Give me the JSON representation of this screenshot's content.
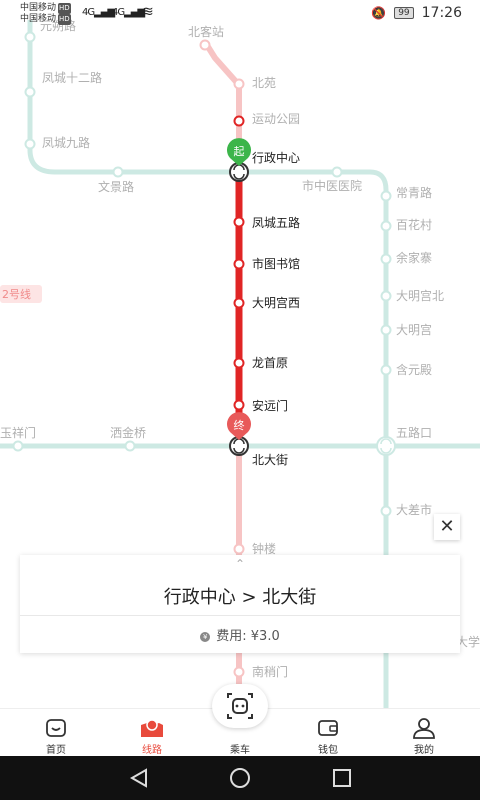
{
  "status_bar": {
    "carrier1": "中国移动",
    "carrier2": "中国移动",
    "hd_label": "HD",
    "net1": "4G",
    "net2": "4G",
    "battery": "99",
    "time": "17:26"
  },
  "map": {
    "stations": {
      "beikezhan": "北客站",
      "beiyuan": "北苑",
      "yundonggongyuan": "运动公园",
      "xingzhengzhongxin": "行政中心",
      "fengchengwulu": "凤城五路",
      "shitushuguan": "市图书馆",
      "damingongxi": "大明宫西",
      "longshouyuan": "龙首原",
      "anyuanmen": "安远门",
      "beidajie": "北大街",
      "zhonglou": "钟楼",
      "nanshaomen": "南稍门",
      "yuanwu": "元朔路",
      "fengcheng12": "凤城十二路",
      "fengcheng9": "凤城九路",
      "wenjinglu": "文景路",
      "shizhongyiyiyuan": "市中医医院",
      "changqinglu": "常青路",
      "baihuacun": "百花村",
      "yujiazhai": "余家寨",
      "damingongbei": "大明宫北",
      "damingong": "大明宫",
      "hanyuandian": "含元殿",
      "wulukou": "五路口",
      "dachashi": "大差市",
      "daxue": "大学",
      "yuxiangmen": "玉祥门",
      "sajinqiao": "洒金桥"
    },
    "line2_tag": "2号线",
    "start_marker": "起",
    "end_marker": "终",
    "colors": {
      "route": "#e02525",
      "line2": "#f7b8b8",
      "green": "#cde9e3",
      "start": "#3cb54a",
      "end": "#e85a5a"
    }
  },
  "close_label": "✕",
  "card": {
    "chevron": "⌃",
    "route_text": "行政中心 > 北大街",
    "coin": "¥",
    "fare_label": "费用:",
    "fare_value": "¥3.0"
  },
  "tabs": [
    {
      "label": "首页",
      "icon": "home-icon"
    },
    {
      "label": "线路",
      "icon": "map-pin-icon"
    },
    {
      "label": "乘车",
      "icon": "qr-scan-icon"
    },
    {
      "label": "钱包",
      "icon": "wallet-icon"
    },
    {
      "label": "我的",
      "icon": "user-icon"
    }
  ]
}
